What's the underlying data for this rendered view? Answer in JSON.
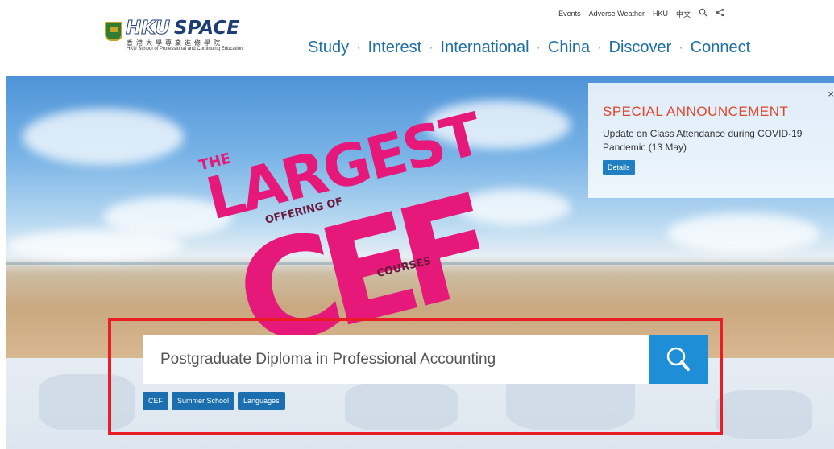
{
  "logo": {
    "name_part1": "HKU",
    "name_part2": "SPACE",
    "chinese": "香港大學專業進修學院",
    "english": "HKU School of Professional and Continuing Education"
  },
  "utility_nav": {
    "items": [
      "Events",
      "Adverse Weather",
      "HKU",
      "中文"
    ],
    "search_icon": "search-icon",
    "share_icon": "share-icon"
  },
  "main_nav": {
    "items": [
      "Study",
      "Interest",
      "International",
      "China",
      "Discover",
      "Connect"
    ],
    "separator": "·"
  },
  "hero": {
    "banner": {
      "the": "THE",
      "largest": "LARGEST",
      "offering_of": "OFFERING OF",
      "cef": "CEF",
      "courses": "COURSES"
    },
    "announcement": {
      "title": "SPECIAL ANNOUNCEMENT",
      "text": "Update on Class Attendance during COVID-19 Pandemic (13 May)",
      "button": "Details",
      "close": "×"
    }
  },
  "search": {
    "value": "Postgraduate Diploma in Professional Accounting",
    "button_icon": "search-icon"
  },
  "quick_tags": [
    "CEF",
    "Summer School",
    "Languages"
  ],
  "colors": {
    "brand_blue": "#1d6fa5",
    "search_button": "#1e8ed6",
    "tag_blue": "#1b6fae",
    "banner_pink": "#e6197a",
    "announcement_title": "#e0462a",
    "highlight_red": "#ea1c24"
  }
}
